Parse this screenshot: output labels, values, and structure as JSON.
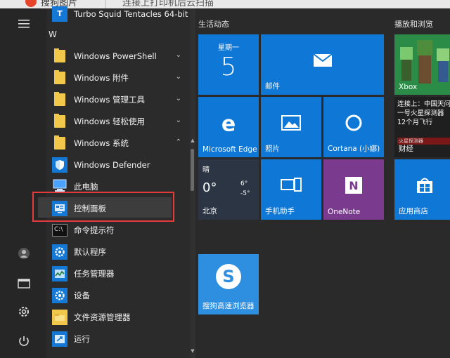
{
  "browser": {
    "title_fragment": "搜狗图片",
    "tab_fragment": "连接上打印机后云扫描"
  },
  "rail": {
    "icons": [
      "hamburger-icon",
      "user-icon",
      "explorer-icon",
      "settings-icon",
      "power-icon"
    ]
  },
  "app_list": {
    "top_item": "Turbo Squid Tentacles 64-bit",
    "letter_w": "W",
    "folders": [
      {
        "label": "Windows PowerShell",
        "chevron": "⌄"
      },
      {
        "label": "Windows 附件",
        "chevron": "⌄"
      },
      {
        "label": "Windows 管理工具",
        "chevron": "⌄"
      },
      {
        "label": "Windows 轻松使用",
        "chevron": "⌄"
      },
      {
        "label": "Windows 系统",
        "chevron": "⌃"
      }
    ],
    "system_items": [
      {
        "label": "Windows Defender",
        "icon": "shield-icon"
      },
      {
        "label": "此电脑",
        "icon": "computer-icon"
      },
      {
        "label": "控制面板",
        "icon": "control-panel-icon"
      },
      {
        "label": "命令提示符",
        "icon": "cmd-icon"
      },
      {
        "label": "默认程序",
        "icon": "gear-icon"
      },
      {
        "label": "任务管理器",
        "icon": "task-manager-icon"
      },
      {
        "label": "设备",
        "icon": "gear-icon"
      },
      {
        "label": "文件资源管理器",
        "icon": "folder-icon"
      },
      {
        "label": "运行",
        "icon": "run-icon"
      }
    ]
  },
  "tiles": {
    "group1_title": "生活动态",
    "group2_title": "播放和浏览",
    "calendar": {
      "day": "星期一",
      "date": "5"
    },
    "mail": {
      "label": "邮件"
    },
    "xbox": {
      "label": "Xbox"
    },
    "edge": {
      "label": "Microsoft Edge"
    },
    "photos": {
      "label": "照片"
    },
    "cortana": {
      "label": "Cortana (小娜)"
    },
    "news": {
      "text": "连接上：中国天问一号火星探测器12个月飞行",
      "label": "财经",
      "badge": "火星探测器"
    },
    "weather": {
      "cond": "晴",
      "temp": "0°",
      "high": "6°",
      "low": "-5°",
      "city": "北京"
    },
    "phone": {
      "label": "手机助手"
    },
    "onenote": {
      "label": "OneNote"
    },
    "store": {
      "label": "应用商店"
    },
    "sogou": {
      "label": "搜狗高速浏览器"
    }
  },
  "colors": {
    "tile_blue": "#0f78d6",
    "highlight": "#e33b3b",
    "onenote": "#7a3b8f"
  }
}
